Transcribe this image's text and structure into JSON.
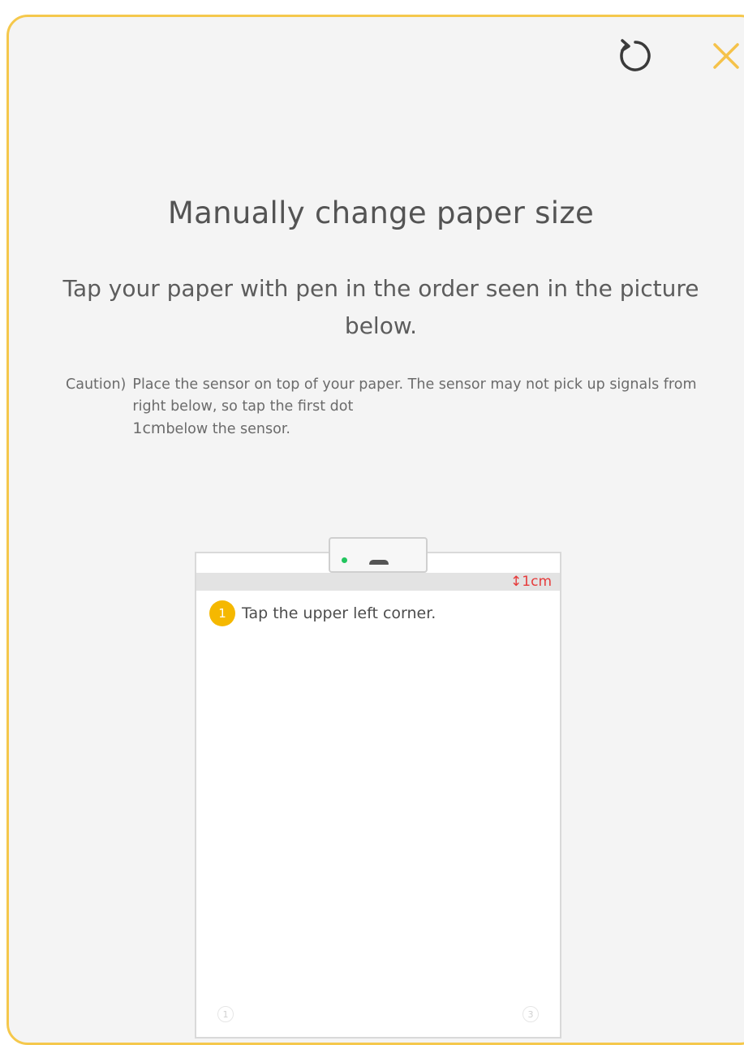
{
  "dialog": {
    "title": "Manually change paper size",
    "subtitle": "Tap your paper with pen in the order seen in the picture below.",
    "caution_label": "Caution)",
    "caution_text_1": "Place the sensor on top of your paper. The sensor may not pick up signals from right below, so tap the first dot",
    "caution_unit": "1cm",
    "caution_text_2": "below the sensor.",
    "icons": {
      "refresh": "refresh-icon",
      "close": "close-icon"
    },
    "colors": {
      "accent": "#f5c84c",
      "step_badge": "#f5b800",
      "measure": "#e63b3b",
      "led": "#22c55e"
    }
  },
  "diagram": {
    "measure_label": "↕1cm",
    "step": {
      "number": "1",
      "text": "Tap the upper left corner."
    },
    "corner_marker_left": "1",
    "corner_marker_right": "3"
  }
}
